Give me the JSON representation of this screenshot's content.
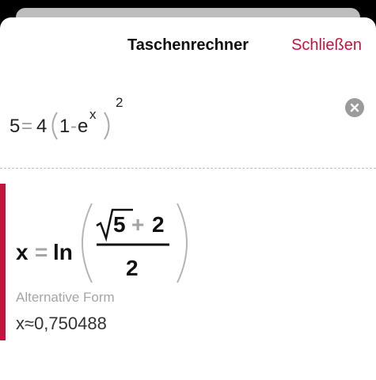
{
  "header": {
    "title": "Taschenrechner",
    "close_label": "Schließen"
  },
  "input": {
    "lhs": "5",
    "equals": "=",
    "coef": "4",
    "one": "1",
    "minus": "-",
    "base": "e",
    "inner_exponent": "x",
    "outer_exponent": "2"
  },
  "result": {
    "variable": "x",
    "equals": "=",
    "function": "ln",
    "sqrt_arg": "5",
    "plus": "+",
    "addend": "2",
    "denominator": "2",
    "alt_label": "Alternative Form",
    "approx_text": "x≈0,750488"
  },
  "colors": {
    "accent": "#c0153f",
    "gray_text": "#a5a5a5"
  }
}
